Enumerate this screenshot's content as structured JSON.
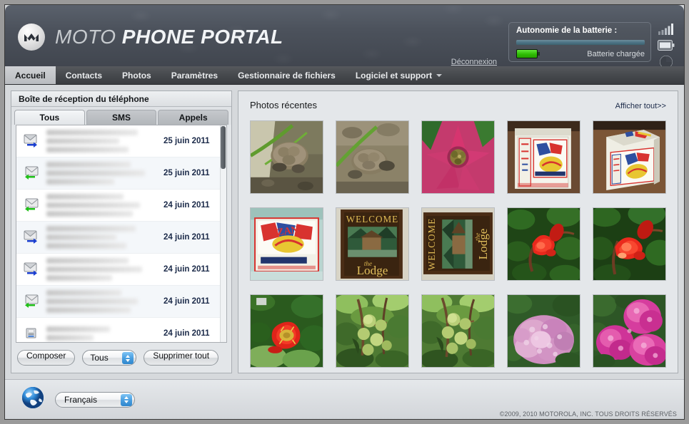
{
  "header": {
    "brand_prefix": "MOTO",
    "brand_main": "PHONE PORTAL",
    "logo_icon": "motorola-m-logo",
    "logout_label": "Déconnexion",
    "battery": {
      "title": "Autonomie de la batterie :",
      "status": "Batterie chargée",
      "level_percent": 100,
      "bar_color": "#4d7486",
      "chip_color": "#2fbd05"
    },
    "side_icons": [
      {
        "name": "signal-bars-icon"
      },
      {
        "name": "battery-icon"
      },
      {
        "name": "memory-pie-icon"
      }
    ]
  },
  "nav": {
    "items": [
      {
        "label": "Accueil",
        "active": true,
        "caret": false
      },
      {
        "label": "Contacts",
        "active": false,
        "caret": false
      },
      {
        "label": "Photos",
        "active": false,
        "caret": false
      },
      {
        "label": "Paramètres",
        "active": false,
        "caret": false
      },
      {
        "label": "Gestionnaire de fichiers",
        "active": false,
        "caret": false
      },
      {
        "label": "Logiciel et support",
        "active": false,
        "caret": true
      }
    ]
  },
  "inbox": {
    "title": "Boîte de réception du téléphone",
    "tabs": [
      {
        "label": "Tous",
        "active": true
      },
      {
        "label": "SMS",
        "active": false
      },
      {
        "label": "Appels",
        "active": false
      }
    ],
    "messages": [
      {
        "direction": "outgoing",
        "icon": "envelope-outgoing-icon",
        "date": "25 juin 2011"
      },
      {
        "direction": "incoming",
        "icon": "envelope-incoming-icon",
        "date": "25 juin 2011"
      },
      {
        "direction": "incoming",
        "icon": "envelope-incoming-icon",
        "date": "24 juin 2011"
      },
      {
        "direction": "outgoing",
        "icon": "envelope-outgoing-icon",
        "date": "24 juin 2011"
      },
      {
        "direction": "outgoing",
        "icon": "envelope-outgoing-icon",
        "date": "24 juin 2011"
      },
      {
        "direction": "incoming",
        "icon": "envelope-incoming-icon",
        "date": "24 juin 2011"
      },
      {
        "direction": "call",
        "icon": "phone-call-icon",
        "date": "24 juin 2011"
      }
    ],
    "compose_label": "Composer",
    "filter_value": "Tous",
    "delete_all_label": "Supprimer tout"
  },
  "photos": {
    "title": "Photos récentes",
    "view_all_label": "Afficher tout>>",
    "thumbnails": [
      {
        "subject": "baby-tortoise-on-ground"
      },
      {
        "subject": "baby-tortoise-closeup"
      },
      {
        "subject": "pink-bromeliad-flower"
      },
      {
        "subject": "vintage-zan-tin-box-side"
      },
      {
        "subject": "vintage-zan-tin-box-angle"
      },
      {
        "subject": "vintage-zan-tin-box-front"
      },
      {
        "subject": "welcome-to-the-lodge-sign"
      },
      {
        "subject": "welcome-to-the-lodge-sign-rotated"
      },
      {
        "subject": "red-pomegranate-flower"
      },
      {
        "subject": "red-pomegranate-flower-closeup"
      },
      {
        "subject": "red-flower-open-bloom"
      },
      {
        "subject": "green-fruit-on-tree"
      },
      {
        "subject": "green-fruit-on-tree-duplicate"
      },
      {
        "subject": "pink-hydrangea-bloom"
      },
      {
        "subject": "magenta-hydrangea-cluster"
      }
    ]
  },
  "footer": {
    "globe_icon": "globe-icon",
    "language_value": "Français",
    "copyright": "©2009, 2010 MOTOROLA, INC. TOUS DROITS RÉSERVÉS"
  }
}
